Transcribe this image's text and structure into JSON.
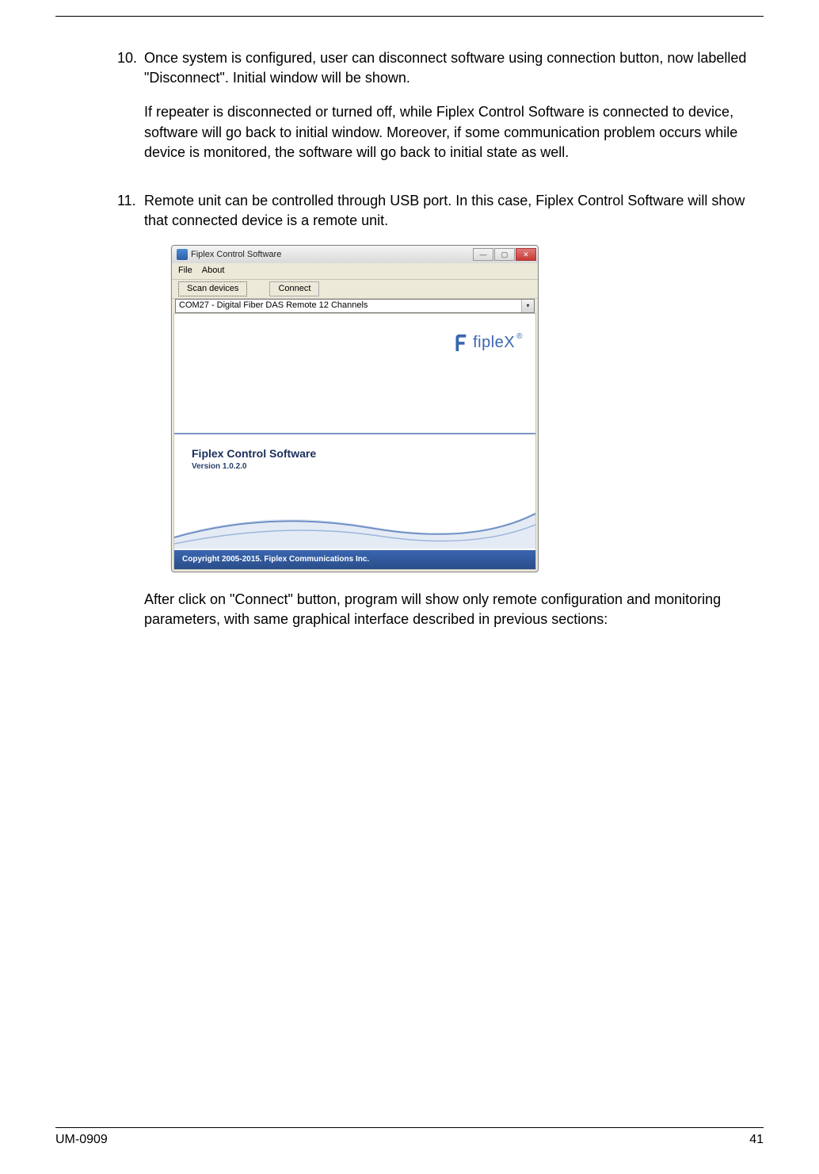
{
  "list": {
    "item10": {
      "num": "10.",
      "p1": "Once system is configured, user can disconnect software using connection button, now labelled \"Disconnect\". Initial window will be shown.",
      "p2": "If repeater is disconnected or turned off, while Fiplex Control Software is connected to device, software will go back to initial window. Moreover, if some communication problem occurs while device is monitored, the software will go back to initial state as well."
    },
    "item11": {
      "num": "11.",
      "p1": "Remote unit can be controlled through USB port. In this case, Fiplex Control Software will show that connected device is a remote unit.",
      "p2": "After click on \"Connect\" button, program will show only remote configuration and monitoring parameters, with same graphical interface described in previous sections:"
    }
  },
  "window": {
    "title": "Fiplex Control Software",
    "menu": {
      "file": "File",
      "about": "About"
    },
    "buttons": {
      "scan": "Scan devices",
      "connect": "Connect"
    },
    "combo": "COM27 - Digital Fiber DAS Remote 12 Channels",
    "logo_text": "fipleX",
    "logo_reg": "®",
    "product": "Fiplex Control Software",
    "version": "Version 1.0.2.0",
    "copyright": "Copyright 2005-2015. Fiplex Communications Inc."
  },
  "footer": {
    "doc": "UM-0909",
    "page": "41"
  }
}
